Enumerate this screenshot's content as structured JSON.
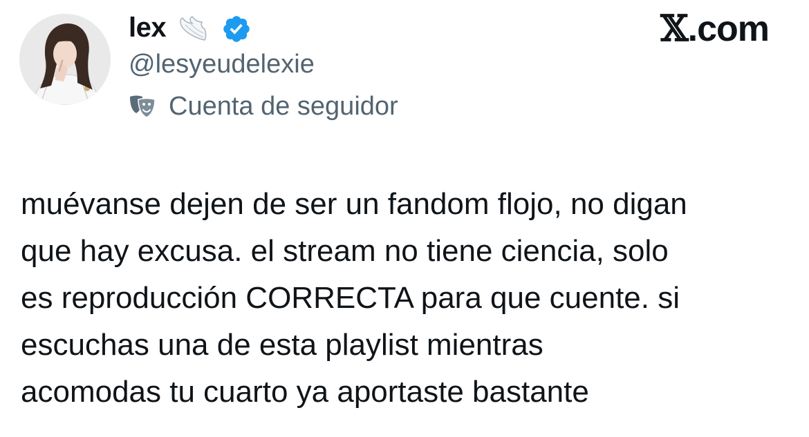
{
  "brand": {
    "label": "𝕏.com",
    "x_glyph": "𝕏",
    "suffix": ".com",
    "icon": "x-logo"
  },
  "author": {
    "display_name": "lex",
    "handle": "@lesyeudelexie",
    "avatar_icon": "avatar-photo",
    "name_emoji_icon": "angel-wing-icon",
    "verified_icon": "verified-badge-icon",
    "verified_color": "#1d9bf0",
    "account_label": "Cuenta de seguidor",
    "account_label_icon": "theater-masks-icon"
  },
  "tweet": {
    "lines": [
      "muévanse dejen de ser un fandom flojo, no digan",
      "que hay excusa. el stream no tiene ciencia, solo",
      "es reproducción CORRECTA para que cuente. si",
      "escuchas una de esta playlist mientras",
      "acomodas tu cuarto ya aportaste bastante"
    ]
  },
  "colors": {
    "text": "#0f1419",
    "secondary": "#536471",
    "background": "#ffffff"
  }
}
